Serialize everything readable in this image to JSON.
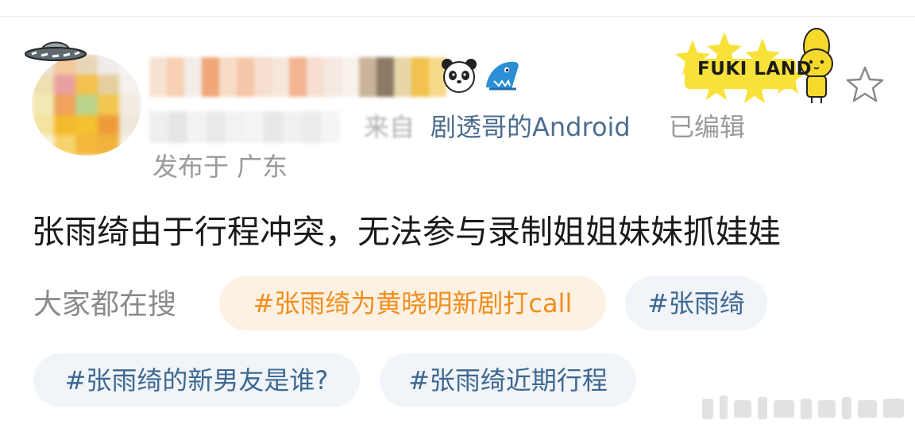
{
  "post": {
    "source_prefix": "来自",
    "source_app": "剧透哥的Android",
    "edited_label": "已编辑",
    "location": "发布于 广东",
    "body_text": "张雨绮由于行程冲突，无法参与录制姐姐妹妹抓娃娃"
  },
  "decoration": {
    "label": "FUKI LAND",
    "icons": [
      "ufo-icon",
      "panda-icon",
      "shark-icon",
      "fuki-land-icon",
      "star-icon"
    ]
  },
  "search": {
    "label": "大家都在搜",
    "chips": [
      "#张雨绮为黄晓明新剧打call",
      "#张雨绮",
      "#张雨绮的新男友是谁?",
      "#张雨绮近期行程"
    ]
  },
  "colors": {
    "link": "#4d6d8f",
    "chip_text": "#3d6891",
    "chip_bg": "#f1f4f8",
    "hot_chip_text": "#f08e1c",
    "hot_chip_bg": "#fdf1e4",
    "muted_text": "#9a9a9a",
    "fuki_yellow": "#f8e23a"
  }
}
